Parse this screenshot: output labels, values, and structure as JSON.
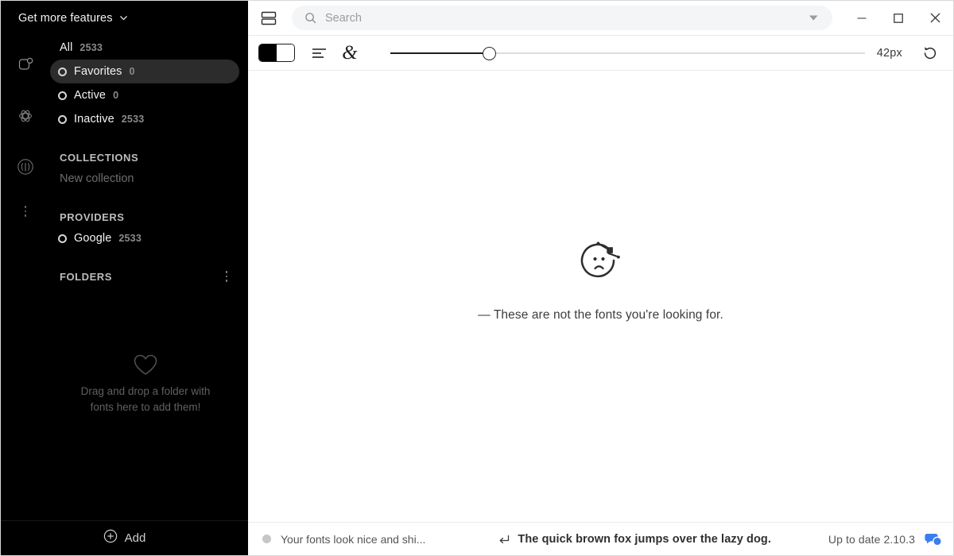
{
  "sidebar": {
    "header": {
      "label": "Get more features",
      "caret_icon": "chevron-down-icon"
    },
    "rail_icons": [
      "tag-folder-icon",
      "atom-icon",
      "broadcast-icon",
      "more-vertical-icon"
    ],
    "library": [
      {
        "label": "All",
        "count": "2533",
        "selected": false,
        "has_radio": false
      },
      {
        "label": "Favorites",
        "count": "0",
        "selected": true,
        "has_radio": true
      },
      {
        "label": "Active",
        "count": "0",
        "selected": false,
        "has_radio": true
      },
      {
        "label": "Inactive",
        "count": "2533",
        "selected": false,
        "has_radio": true
      }
    ],
    "collections": {
      "title": "COLLECTIONS",
      "empty_item": "New collection"
    },
    "providers": {
      "title": "PROVIDERS",
      "items": [
        {
          "label": "Google",
          "count": "2533"
        }
      ]
    },
    "folders": {
      "title": "FOLDERS",
      "menu_icon": "more-vertical-icon",
      "drop_icon": "heart-icon",
      "drop_text": "Drag and drop a folder with fonts here to add them!"
    },
    "footer": {
      "add_label": "Add",
      "add_icon": "plus-circle-icon"
    }
  },
  "titlebar": {
    "panel_icon": "panel-layout-icon",
    "search": {
      "icon": "search-icon",
      "placeholder": "Search",
      "value": "",
      "filter_icon": "caret-down-icon"
    },
    "window_controls": [
      {
        "name": "minimize",
        "icon": "minimize-icon"
      },
      {
        "name": "maximize",
        "icon": "maximize-icon"
      },
      {
        "name": "close",
        "icon": "close-icon"
      }
    ]
  },
  "toolbar": {
    "theme_toggle": {
      "icon": "theme-toggle-icon",
      "state": "split"
    },
    "align_icon": "align-left-icon",
    "glyph_icon": "ampersand-icon",
    "size_slider": {
      "value": 42,
      "min": 8,
      "max": 300,
      "percent": 20.8
    },
    "size_label": "42px",
    "reset_icon": "reset-icon"
  },
  "canvas": {
    "illustration": "sad-face-icon",
    "empty_message": "— These are not the fonts you're looking for."
  },
  "statusbar": {
    "status_dot_color": "#c6c6c6",
    "status_text": "Your fonts look nice and shi...",
    "preview_icon": "enter-key-icon",
    "preview_text": "The quick brown fox jumps over the lazy dog.",
    "version_text": "Up to date 2.10.3",
    "chat_icon": "chat-bubbles-icon",
    "chat_color": "#3b7ef0"
  },
  "colors": {
    "sidebar_bg": "#000000",
    "selected_pill": "#2c2c2c",
    "main_bg": "#ffffff",
    "accent_blue": "#3b7ef0"
  }
}
